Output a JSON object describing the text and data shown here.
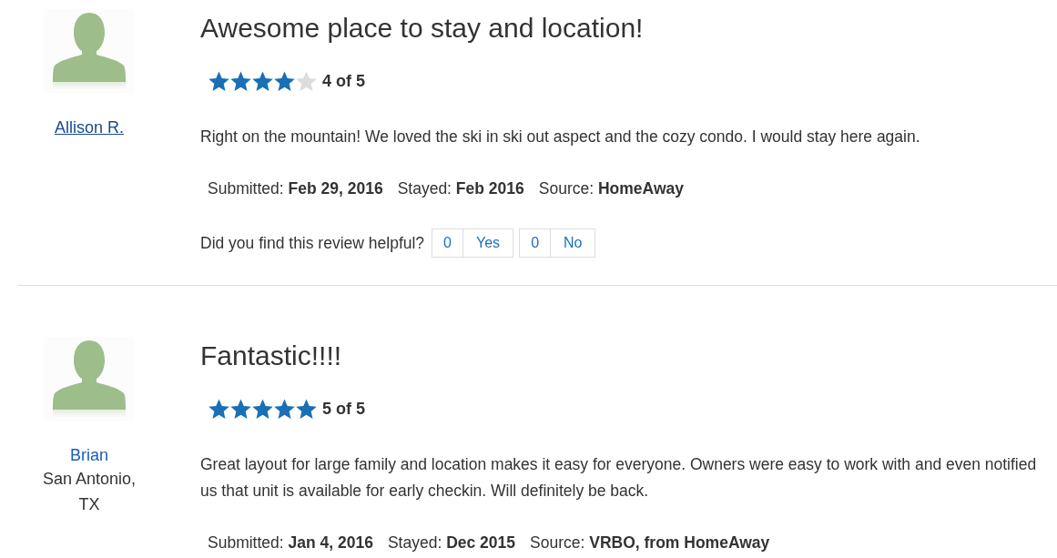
{
  "reviews": [
    {
      "author": {
        "name": "Allison R.",
        "underlined": true
      },
      "title": "Awesome place to stay and location!",
      "stars": 4,
      "rating_text": "4 of 5",
      "body": "Right on the mountain! We loved the ski in ski out aspect and the cozy condo. I would stay here again.",
      "meta": [
        {
          "label": "Submitted:",
          "value": "Feb 29, 2016"
        },
        {
          "label": "Stayed:",
          "value": "Feb 2016"
        },
        {
          "label": "Source:",
          "value": "HomeAway"
        }
      ],
      "helpful": {
        "question": "Did you find this review helpful?",
        "votes": [
          {
            "count": "0",
            "label": "Yes"
          },
          {
            "count": "0",
            "label": "No"
          }
        ]
      }
    },
    {
      "author": {
        "name": "Brian",
        "underlined": false
      },
      "location": "San Antonio, TX",
      "title": "Fantastic!!!!",
      "stars": 5,
      "rating_text": "5 of 5",
      "body": "Great layout for large family and location makes it easy for everyone. Owners were easy to work with and even notified us that unit is available for early checkin. Will definitely be back.",
      "meta": [
        {
          "label": "Submitted:",
          "value": "Jan 4, 2016"
        },
        {
          "label": "Stayed:",
          "value": "Dec 2015"
        },
        {
          "label": "Source:",
          "value": "VRBO, from HomeAway"
        }
      ]
    }
  ]
}
